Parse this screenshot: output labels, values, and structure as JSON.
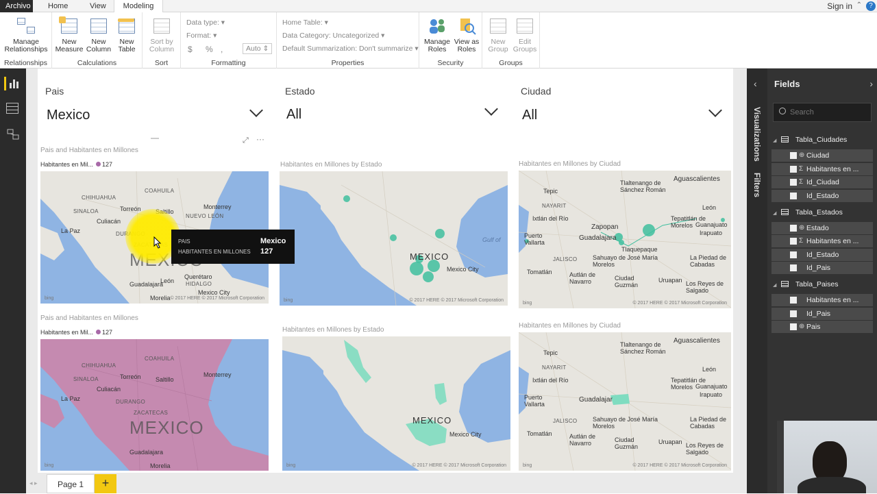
{
  "tabs": {
    "file": "Archivo",
    "home": "Home",
    "view": "View",
    "modeling": "Modeling"
  },
  "signin": "Sign in",
  "ribbon": {
    "relationships": {
      "manage": [
        "Manage",
        "Relationships"
      ],
      "group": "Relationships"
    },
    "calculations": {
      "new_measure": [
        "New",
        "Measure"
      ],
      "new_column": [
        "New",
        "Column"
      ],
      "new_table": [
        "New",
        "Table"
      ],
      "group": "Calculations"
    },
    "sort": {
      "sort_by_column": [
        "Sort by",
        "Column"
      ],
      "group": "Sort"
    },
    "formatting": {
      "data_type": "Data type:",
      "format": "Format:",
      "currency": "$",
      "percent": "%",
      "comma": ",",
      "auto": "Auto",
      "group": "Formatting"
    },
    "properties": {
      "home_table": "Home Table:",
      "data_category": "Data Category: Uncategorized",
      "default_summarization": "Default Summarization: Don't summarize",
      "group": "Properties"
    },
    "security": {
      "manage_roles": [
        "Manage",
        "Roles"
      ],
      "view_as_roles": [
        "View as",
        "Roles"
      ],
      "group": "Security"
    },
    "groups": {
      "new_group": [
        "New",
        "Group"
      ],
      "edit_groups": [
        "Edit",
        "Groups"
      ],
      "group": "Groups"
    }
  },
  "slicers": [
    {
      "title": "Pais",
      "value": "Mexico"
    },
    {
      "title": "Estado",
      "value": "All"
    },
    {
      "title": "Ciudad",
      "value": "All"
    }
  ],
  "visuals": {
    "v1": {
      "title": "Pais and Habitantes en Millones",
      "legend_label": "Habitantes en Mil...",
      "legend_value": "127"
    },
    "v2": {
      "title": "Habitantes en Millones by Estado"
    },
    "v3": {
      "title": "Habitantes en Millones by Ciudad"
    },
    "v4": {
      "title": "Pais and Habitantes en Millones",
      "legend_label": "Habitantes en Mil...",
      "legend_value": "127"
    },
    "v5": {
      "title": "Habitantes en Millones by Estado"
    },
    "v6": {
      "title": "Habitantes en Millones by Ciudad"
    }
  },
  "tooltip": {
    "k1": "PAIS",
    "v1": "Mexico",
    "k2": "HABITANTES EN MILLONES",
    "v2": "127"
  },
  "map_labels": {
    "mexico": "MEXICO",
    "mexico_city": "Mexico City",
    "gulf": "Gulf of",
    "la_paz": "La Paz",
    "culiacan": "Culiacán",
    "torreon": "Torreón",
    "saltillo": "Saltillo",
    "monterrey": "Monterrey",
    "guadalajara": "Guadalajara",
    "leon": "León",
    "queretaro": "Querétaro",
    "morelia": "Morelia",
    "coahuila": "Coahuila",
    "chihuahua": "Chihuahua",
    "sinaloa": "Sinaloa",
    "durango": "Durango",
    "zacatecas": "Zacatecas",
    "nuevo_leon": "Nuevo León",
    "hidalgo": "Hidalgo",
    "tepic": "Tepic",
    "nayarit": "Nayarit",
    "ixtlan": "Ixtlán del Río",
    "puerto_vallarta": "Puerto Vallarta",
    "zapopan": "Zapopan",
    "guadalajar": "Guadalajar",
    "aguascalientes": "Aguascalientes",
    "tlaltenango": "Tlaltenango de Sánchez Román",
    "tepatitlan": "Tepatitlán de Morelos",
    "guanajuato": "Guanajuato",
    "irapuato": "Irapuato",
    "tlaquepaque": "Tlaquepaque",
    "sahuayo": "Sahuayo de José María Morelos",
    "jalisco": "Jalisco",
    "tomatlan": "Tomatlán",
    "autlan": "Autlán de Navarro",
    "ciudad_guzman": "Ciudad Guzmán",
    "uruapan": "Uruapan",
    "la_piedad": "La Piedad de Cabadas",
    "los_reyes": "Los Reyes de Salgado",
    "copyright": "© 2017 HERE  © 2017 Microsoft Corporation",
    "bing": "bing"
  },
  "page_tab": "Page 1",
  "add_page": "+",
  "fields_pane": {
    "title": "Fields",
    "search_placeholder": "Search",
    "visualizations_label": "Visualizations",
    "filters_label": "Filters",
    "tables": [
      {
        "name": "Tabla_Ciudades",
        "fields": [
          "Ciudad",
          "Habitantes en ...",
          "Id_Ciudad",
          "Id_Estado"
        ]
      },
      {
        "name": "Tabla_Estados",
        "fields": [
          "Estado",
          "Habitantes en ...",
          "Id_Estado",
          "Id_Pais"
        ]
      },
      {
        "name": "Tabla_Paises",
        "fields": [
          "Habitantes en ...",
          "Id_Pais",
          "Pais"
        ]
      }
    ]
  },
  "colors": {
    "accent": "#f2c811",
    "map_water": "#8fb4e3",
    "map_land": "#e7e5df",
    "bubble": "#3fbf9f",
    "filled_country": "#c58ab0",
    "filled_state": "#7fdcc0"
  }
}
